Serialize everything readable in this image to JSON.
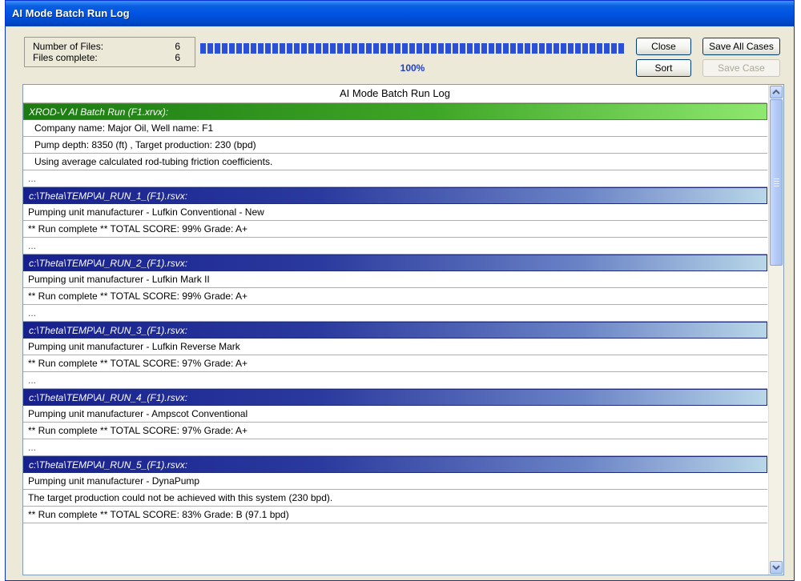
{
  "window": {
    "title": "AI Mode Batch Run Log"
  },
  "summary": {
    "files_label": "Number of Files:",
    "files_value": "6",
    "complete_label": "Files complete:",
    "complete_value": "6",
    "progress_percent": 100,
    "progress_text": "100%"
  },
  "buttons": {
    "close": "Close",
    "sort": "Sort",
    "save_all": "Save All Cases",
    "save_case": "Save Case"
  },
  "log": {
    "header": "AI Mode Batch Run Log",
    "rows": [
      {
        "text": "XROD-V AI Batch Run (F1.xrvx):",
        "style": "head-green"
      },
      {
        "text": "Company name: Major Oil,  Well name: F1",
        "style": "indent"
      },
      {
        "text": "Pump depth: 8350 (ft) ,  Target production: 230 (bpd)",
        "style": "indent"
      },
      {
        "text": "Using average calculated rod-tubing friction coefficients.",
        "style": "indent"
      },
      {
        "text": "...",
        "style": "ellipsis"
      },
      {
        "text": "c:\\Theta\\TEMP\\AI_RUN_1_(F1).rsvx:",
        "style": "head-blue"
      },
      {
        "text": "Pumping unit manufacturer -  Lufkin Conventional - New",
        "style": "plain"
      },
      {
        "text": "** Run complete **    TOTAL SCORE: 99%  Grade: A+",
        "style": "plain"
      },
      {
        "text": "...",
        "style": "ellipsis"
      },
      {
        "text": "c:\\Theta\\TEMP\\AI_RUN_2_(F1).rsvx:",
        "style": "head-blue"
      },
      {
        "text": "Pumping unit manufacturer -  Lufkin Mark II",
        "style": "plain"
      },
      {
        "text": "** Run complete **    TOTAL SCORE: 99%  Grade: A+",
        "style": "plain"
      },
      {
        "text": "...",
        "style": "ellipsis"
      },
      {
        "text": "c:\\Theta\\TEMP\\AI_RUN_3_(F1).rsvx:",
        "style": "head-blue"
      },
      {
        "text": "Pumping unit manufacturer -  Lufkin Reverse Mark",
        "style": "plain"
      },
      {
        "text": "** Run complete **    TOTAL SCORE: 97%  Grade: A+",
        "style": "plain"
      },
      {
        "text": "...",
        "style": "ellipsis"
      },
      {
        "text": "c:\\Theta\\TEMP\\AI_RUN_4_(F1).rsvx:",
        "style": "head-blue"
      },
      {
        "text": "Pumping unit manufacturer -  Ampscot Conventional",
        "style": "plain"
      },
      {
        "text": "** Run complete **    TOTAL SCORE: 97%  Grade: A+",
        "style": "plain"
      },
      {
        "text": "...",
        "style": "ellipsis"
      },
      {
        "text": "c:\\Theta\\TEMP\\AI_RUN_5_(F1).rsvx:",
        "style": "head-blue"
      },
      {
        "text": "Pumping unit manufacturer -  DynaPump",
        "style": "plain"
      },
      {
        "text": "The target production could not be achieved with this system  (230  bpd).",
        "style": "plain"
      },
      {
        "text": "** Run complete **    TOTAL SCORE: 83%  Grade: B  (97.1  bpd)",
        "style": "plain"
      }
    ]
  },
  "icons": {
    "scroll_up": "chevron-up-icon",
    "scroll_down": "chevron-down-icon"
  },
  "colors": {
    "progress": "#2a50d8",
    "title_bar": "#0054e3",
    "percent_text": "#1f3ec9"
  }
}
